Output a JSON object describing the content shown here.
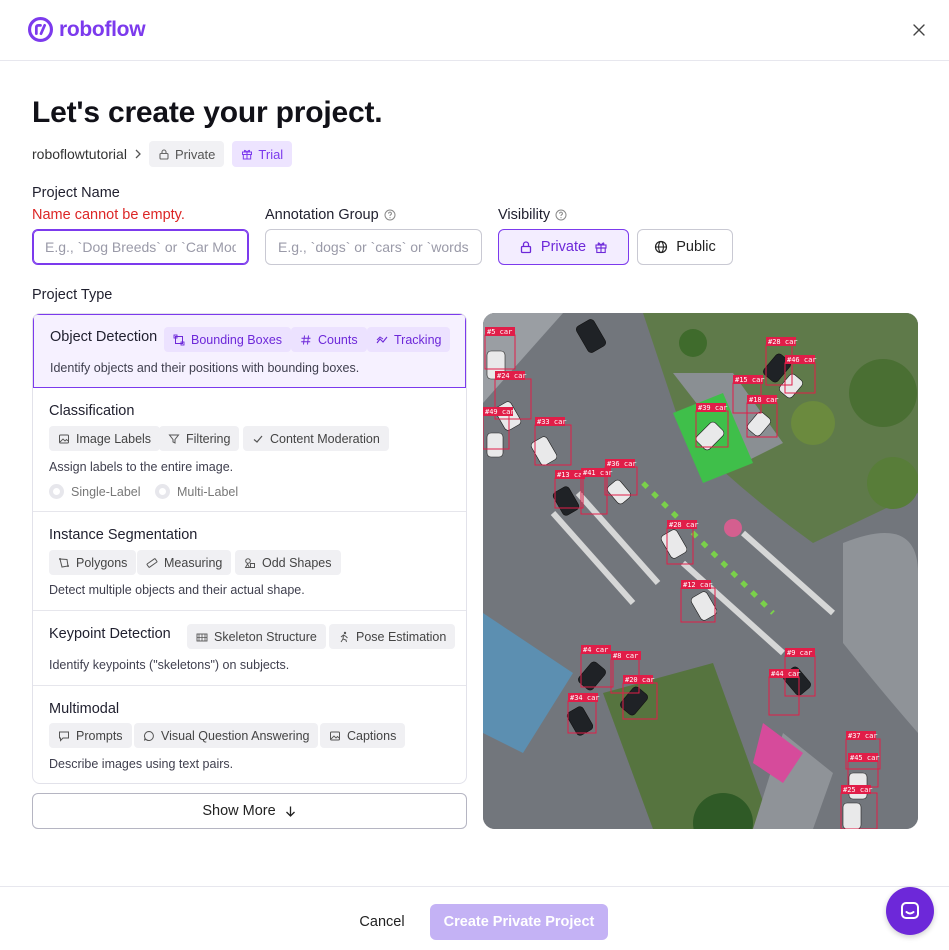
{
  "brand": {
    "name": "roboflow",
    "color": "#7c3aed"
  },
  "page": {
    "title": "Let's create your project."
  },
  "breadcrumb": {
    "workspace": "roboflowtutorial",
    "privacy_badge": "Private",
    "plan_badge": "Trial"
  },
  "form": {
    "project_name": {
      "label": "Project Name",
      "error": "Name cannot be empty.",
      "placeholder": "E.g., `Dog Breeds` or `Car Models`",
      "value": ""
    },
    "annotation_group": {
      "label": "Annotation Group",
      "placeholder": "E.g., `dogs` or `cars` or `words`",
      "value": ""
    },
    "visibility": {
      "label": "Visibility",
      "private_label": "Private",
      "public_label": "Public",
      "selected": "Private"
    },
    "project_type_label": "Project Type"
  },
  "project_types": [
    {
      "name": "Object Detection",
      "selected": true,
      "tags": [
        "Bounding Boxes",
        "Counts",
        "Tracking"
      ],
      "description": "Identify objects and their positions with bounding boxes."
    },
    {
      "name": "Classification",
      "selected": false,
      "tags": [
        "Image Labels",
        "Filtering",
        "Content Moderation"
      ],
      "description": "Assign labels to the entire image.",
      "options": [
        "Single-Label",
        "Multi-Label"
      ]
    },
    {
      "name": "Instance Segmentation",
      "selected": false,
      "tags": [
        "Polygons",
        "Measuring",
        "Odd Shapes"
      ],
      "description": "Detect multiple objects and their actual shape."
    },
    {
      "name": "Keypoint Detection",
      "selected": false,
      "tags": [
        "Skeleton Structure",
        "Pose Estimation"
      ],
      "description": "Identify keypoints (\"skeletons\") on subjects."
    },
    {
      "name": "Multimodal",
      "selected": false,
      "tags": [
        "Prompts",
        "Visual Question Answering",
        "Captions"
      ],
      "description": "Describe images using text pairs."
    }
  ],
  "show_more_label": "Show More",
  "preview": {
    "detections": [
      "#5 car",
      "#24 car",
      "#49 car",
      "#33 car",
      "#13 car",
      "#41 car",
      "#36 car",
      "#28 car",
      "#39 car",
      "#15 car",
      "#18 car",
      "#28 car",
      "#46 car",
      "#12 car",
      "#4 car",
      "#8 car",
      "#20 car",
      "#34 car",
      "#9 car",
      "#44 car",
      "#37 car",
      "#45 car",
      "#25 car"
    ],
    "box_color": "#e11d48"
  },
  "footer": {
    "cancel_label": "Cancel",
    "create_label": "Create Private Project"
  }
}
